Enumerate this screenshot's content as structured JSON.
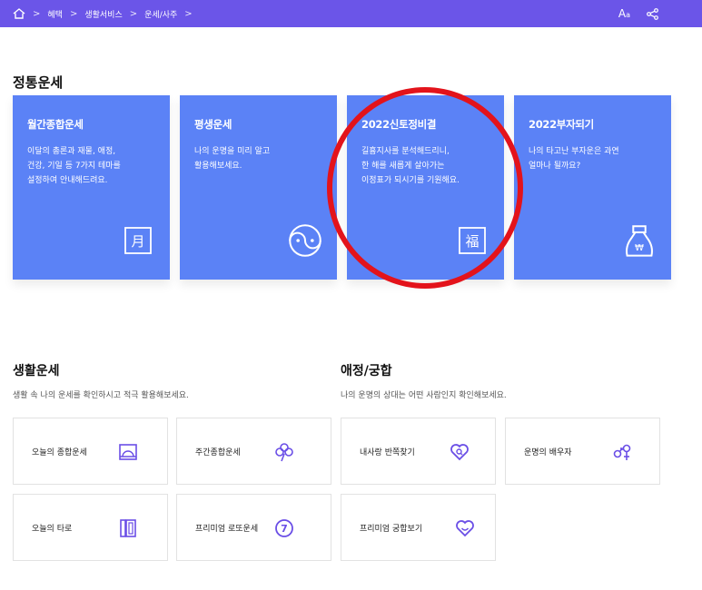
{
  "breadcrumb": {
    "items": [
      "혜택",
      "생활서비스",
      "운세/사주"
    ],
    "separator": ">"
  },
  "header": {
    "font_size_label": "A",
    "font_size_small": "a"
  },
  "main_section": {
    "title": "정통운세"
  },
  "cards": [
    {
      "title": "월간종합운세",
      "desc": "이달의 총론과 재물, 애정,\n건강, 기일 등 7가지 테마를\n설정하여 안내해드려요.",
      "icon": "calendar-month-icon",
      "glyph": "月"
    },
    {
      "title": "평생운세",
      "desc": "나의 운명을 미리 알고\n활용해보세요.",
      "icon": "yin-yang-icon"
    },
    {
      "title": "2022신토정비결",
      "desc": "길흉지사를 분석해드리니,\n한 해를 새롭게 살아가는\n이정표가 되시기를 기원해요.",
      "icon": "fortune-bok-icon",
      "glyph": "福"
    },
    {
      "title": "2022부자되기",
      "desc": "나의 타고난 부자운은 과연\n얼마나 될까요?",
      "icon": "money-bag-icon",
      "glyph": "₩"
    }
  ],
  "life": {
    "title": "생활운세",
    "desc": "생활 속 나의 운세를 확인하시고 적극 활용해보세요.",
    "tiles": [
      {
        "label": "오늘의 종합운세",
        "icon": "sunrise-icon"
      },
      {
        "label": "주간종합운세",
        "icon": "clover-icon"
      },
      {
        "label": "오늘의 타로",
        "icon": "tarot-cards-icon"
      },
      {
        "label": "프리미엄 로또운세",
        "icon": "lotto-ball-icon",
        "glyph": "7"
      }
    ]
  },
  "love": {
    "title": "애정/궁합",
    "desc": "나의 운명의 상대는 어떤 사람인지 확인해보세요.",
    "tiles": [
      {
        "label": "내사랑 반쪽찾기",
        "icon": "heart-search-icon"
      },
      {
        "label": "운명의 배우자",
        "icon": "couple-symbol-icon"
      },
      {
        "label": "프리미엄 궁합보기",
        "icon": "heart-ring-icon"
      }
    ]
  },
  "colors": {
    "topbar": "#6b55e8",
    "card": "#5b82f6",
    "accent_icon": "#6a4ee6",
    "annotation": "#e3131b"
  }
}
